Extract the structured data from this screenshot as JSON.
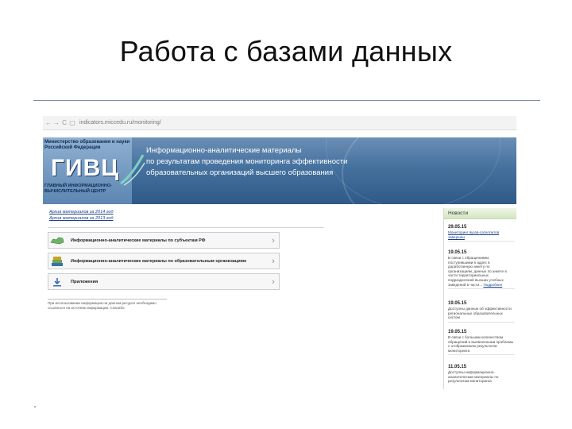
{
  "slide": {
    "title": "Работа с базами данных"
  },
  "browser": {
    "back": "←",
    "forward": "→",
    "reload": "C",
    "url": "indicators.miccedu.ru/monitoring/"
  },
  "banner": {
    "org_top": "Министерство образования и науки Российской Федерации",
    "logo_text": "ГИВЦ",
    "org_bottom": "ГЛАВНЫЙ ИНФОРМАЦИОННО-ВЫЧИСЛИТЕЛЬНЫЙ ЦЕНТР",
    "headline_1": "Информационно-аналитические материалы",
    "headline_2": "по результатам проведения мониторинга эффективности",
    "headline_3": "образовательных организаций высшего образования"
  },
  "archive_links": [
    "Архив материалов за 2014 год",
    "Архив материалов за 2013 год"
  ],
  "menu": [
    {
      "label": "Информационно-аналитические материалы по субъектам РФ",
      "icon": "map-icon"
    },
    {
      "label": "Информационно-аналитические материалы по образовательным организациям",
      "icon": "books-icon"
    },
    {
      "label": "Приложения",
      "icon": "download-icon"
    }
  ],
  "footnote": "При использовании информации на данном ресурсе необходимо ссылаться на источник информации. Спасибо.",
  "news": {
    "title": "Новости",
    "items": [
      {
        "date": "29.05.15",
        "text": "Мониторинг вузов-сателлитов завершен",
        "link": true
      },
      {
        "date": "19.05.15",
        "text": "В связи с обращениями, поступившими в адрес в доработанную анкету по организациям, данных по анкете в части территориальных подразделений высших учебных заведений в части...",
        "more": "Подробнее"
      },
      {
        "date": "19.05.15",
        "text": "Доступны данные об эффективности региональных образовательных систем"
      },
      {
        "date": "19.05.15",
        "text": "В связи с большим количеством обращений и выявленными проблемы с отображением результатов мониторинга"
      },
      {
        "date": "11.05.15",
        "text": "Доступны информационно-аналитические материалы по результатам мониторинга"
      }
    ]
  },
  "colors": {
    "banner_dark": "#2f5a87",
    "banner_light": "#6b8fb6",
    "news_header": "#d3e6c0",
    "link": "#1a3f8a"
  }
}
